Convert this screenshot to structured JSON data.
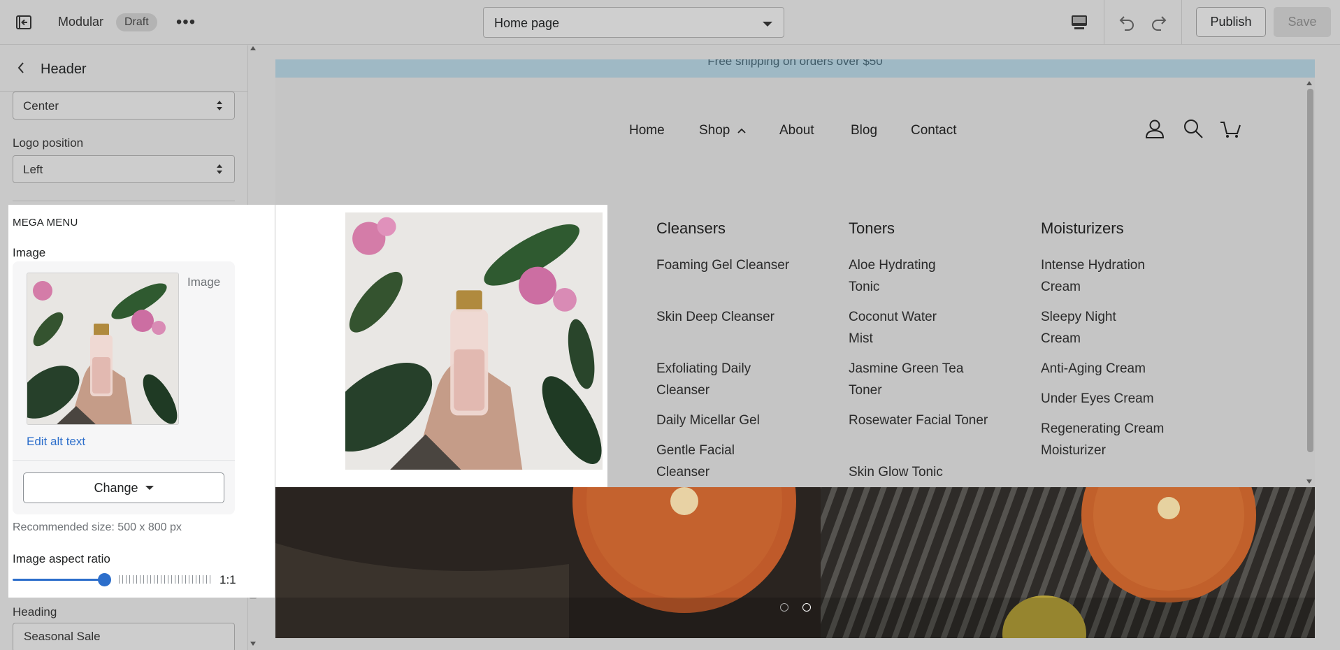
{
  "topbar": {
    "theme_name": "Modular",
    "status_badge": "Draft",
    "page_selector": "Home page",
    "publish_label": "Publish",
    "save_label": "Save"
  },
  "sidebar": {
    "title": "Header",
    "alignment_value": "Center",
    "logo_position_label": "Logo position",
    "logo_position_value": "Left",
    "mega_menu_label": "MEGA MENU",
    "image_label": "Image",
    "image_caption": "Image",
    "edit_alt_text": "Edit alt text",
    "change_label": "Change",
    "recommended_size": "Recommended size: 500 x 800 px",
    "aspect_ratio_label": "Image aspect ratio",
    "aspect_ratio_value": "1:1",
    "aspect_ratio_fraction": 0.5,
    "heading_label": "Heading",
    "heading_value": "Seasonal Sale"
  },
  "preview": {
    "announcement": "Free shipping on orders over $50",
    "nav": [
      "Home",
      "Shop",
      "About",
      "Blog",
      "Contact"
    ],
    "columns": [
      {
        "heading": "Cleansers",
        "items": [
          "Foaming Gel Cleanser",
          "Skin Deep Cleanser",
          "Exfoliating Daily Cleanser",
          "Daily Micellar Gel",
          "Gentle Facial Cleanser"
        ]
      },
      {
        "heading": "Toners",
        "items": [
          "Aloe Hydrating Tonic",
          "Coconut Water Mist",
          "Jasmine Green Tea Toner",
          "Rosewater Facial Toner",
          "Skin Glow Tonic"
        ]
      },
      {
        "heading": "Moisturizers",
        "items": [
          "Intense Hydration Cream",
          "Sleepy Night Cream",
          "Anti-Aging Cream",
          "Under Eyes Cream",
          "Regenerating Cream Moisturizer"
        ]
      }
    ],
    "slideshow_dots": 2,
    "active_dot": 2
  }
}
